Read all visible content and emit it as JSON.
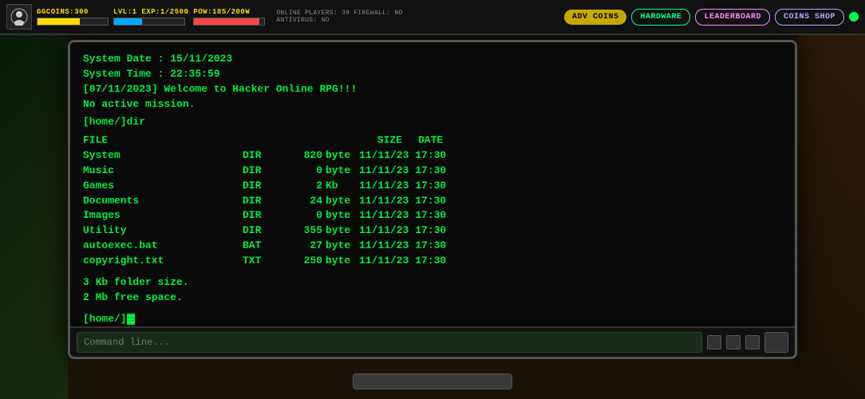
{
  "hud": {
    "logo_icon": "👤",
    "coins_label": "GGCOINS:300",
    "coins_value": "300",
    "level_label": "LVL:1 EXP:1/2500",
    "pow_label": "POW:185/200W",
    "info_line1": "ONLINE PLAYERS: 39    FIREWALL: NO",
    "info_line2": "ANTIVIRUS: NO",
    "btn_adv_coins": "ADV COINS",
    "btn_hardware": "HARDWARE",
    "btn_leaderboard": "LEADERBOARD",
    "btn_coins_shop": "COINS SHOP"
  },
  "terminal": {
    "line1": "System Date : 15/11/2023",
    "line2": "System Time : 22:35:59",
    "line3": "[07/11/2023] Welcome to Hacker Online RPG!!!",
    "line4": "No active mission.",
    "line5": "[home/]dir",
    "header_file": "FILE",
    "header_size": "SIZE",
    "header_date": "DATE",
    "files": [
      {
        "name": "System",
        "type": "DIR",
        "size": "820",
        "unit": "byte",
        "date": "11/11/23 17:30"
      },
      {
        "name": "Music",
        "type": "DIR",
        "size": "0",
        "unit": "byte",
        "date": "11/11/23 17:30"
      },
      {
        "name": "Games",
        "type": "DIR",
        "size": "2",
        "unit": "Kb",
        "date": "11/11/23 17:30"
      },
      {
        "name": "Documents",
        "type": "DIR",
        "size": "24",
        "unit": "byte",
        "date": "11/11/23 17:30"
      },
      {
        "name": "Images",
        "type": "DIR",
        "size": "0",
        "unit": "byte",
        "date": "11/11/23 17:30"
      },
      {
        "name": "Utility",
        "type": "DIR",
        "size": "355",
        "unit": "byte",
        "date": "11/11/23 17:30"
      },
      {
        "name": "autoexec.bat",
        "type": "BAT",
        "size": "27",
        "unit": "byte",
        "date": "11/11/23 17:30"
      },
      {
        "name": "copyright.txt",
        "type": "TXT",
        "size": "250",
        "unit": "byte",
        "date": "11/11/23 17:30"
      }
    ],
    "footer1": "3 Kb folder size.",
    "footer2": "2 Mb free space.",
    "prompt": "[home/]",
    "command_placeholder": "Command line..."
  }
}
